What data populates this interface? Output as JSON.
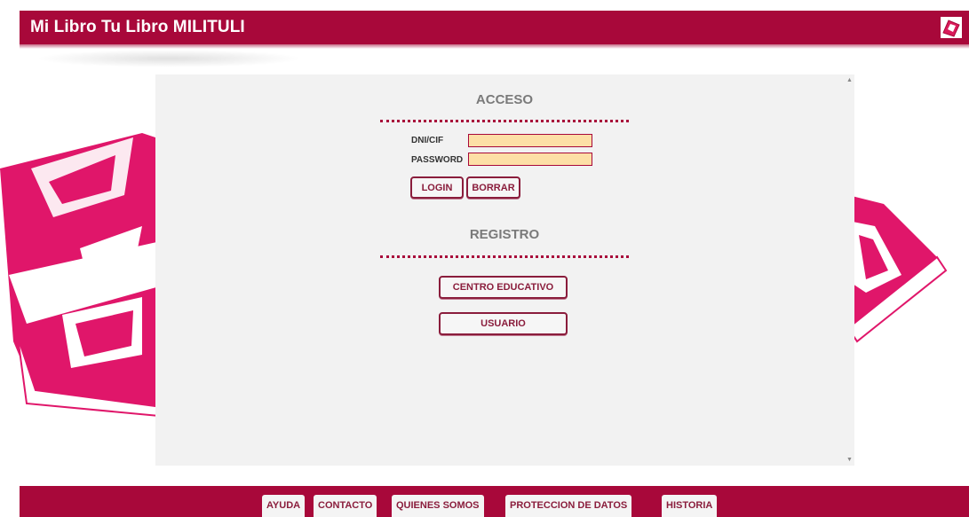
{
  "header": {
    "title": "Mi Libro Tu Libro MILITULI",
    "logo_icon": "book-logo-icon"
  },
  "acceso": {
    "title": "ACCESO",
    "dni_label": "DNI/CIF",
    "dni_value": "",
    "password_label": "PASSWORD",
    "password_value": "",
    "login_label": "LOGIN",
    "borrar_label": "BORRAR"
  },
  "registro": {
    "title": "REGISTRO",
    "centro_label": "CENTRO EDUCATIVO",
    "usuario_label": "USUARIO"
  },
  "footer": {
    "items": [
      "AYUDA",
      "CONTACTO",
      "QUIENES SOMOS",
      "PROTECCION DE DATOS",
      "HISTORIA"
    ]
  },
  "colors": {
    "brand": "#a8083a",
    "field_bg": "#fddfa6",
    "panel_bg": "#f2f2f2"
  }
}
